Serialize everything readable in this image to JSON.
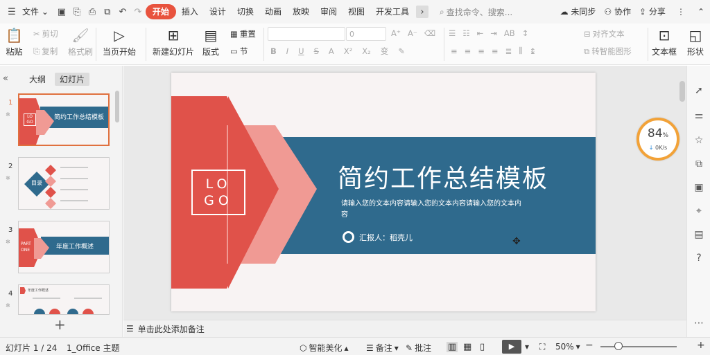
{
  "menubar": {
    "file": "文件",
    "tabs": [
      "开始",
      "插入",
      "设计",
      "切换",
      "动画",
      "放映",
      "审阅",
      "视图",
      "开发工具"
    ],
    "active_tab": "开始",
    "search_placeholder": "查找命令、搜索...",
    "sync": "未同步",
    "collab": "协作",
    "share": "分享"
  },
  "ribbon": {
    "paste": "粘贴",
    "cut": "剪切",
    "copy": "复制",
    "format_painter": "格式刷",
    "play_from_current": "当页开始",
    "new_slide": "新建幻灯片",
    "layout": "版式",
    "reset": "重置",
    "section": "节",
    "font_size": "0",
    "align_text": "对齐文本",
    "smart_graphic": "转智能图形",
    "textbox": "文本框",
    "shape": "形状"
  },
  "leftpane": {
    "tab_outline": "大纲",
    "tab_slides": "幻灯片",
    "thumbs": [
      {
        "num": "1",
        "title": "简约工作总结模板",
        "logo": "LO GO"
      },
      {
        "num": "2",
        "title": "目录"
      },
      {
        "num": "3",
        "title": "年度工作概述",
        "part": "PART ONE"
      },
      {
        "num": "4",
        "title": "年度工作概述"
      }
    ]
  },
  "slide": {
    "logo": "LO GO",
    "title": "简约工作总结模板",
    "subtitle": "请输入您的文本内容请输入您的文本内容请输入您的文本内容",
    "reporter": "汇报人：稻壳儿"
  },
  "speed": {
    "percent": "84",
    "unit": "%",
    "net": "0K/s"
  },
  "notes": {
    "placeholder": "单击此处添加备注"
  },
  "status": {
    "slide_count": "幻灯片 1 / 24",
    "theme": "1_Office 主题",
    "beautify": "智能美化",
    "notes": "备注",
    "comments": "批注",
    "zoom": "50%"
  },
  "colors": {
    "accent": "#e8533e",
    "slide_blue": "#2f6a8d",
    "slide_red": "#e0524a",
    "slide_pink": "#f09a94"
  }
}
